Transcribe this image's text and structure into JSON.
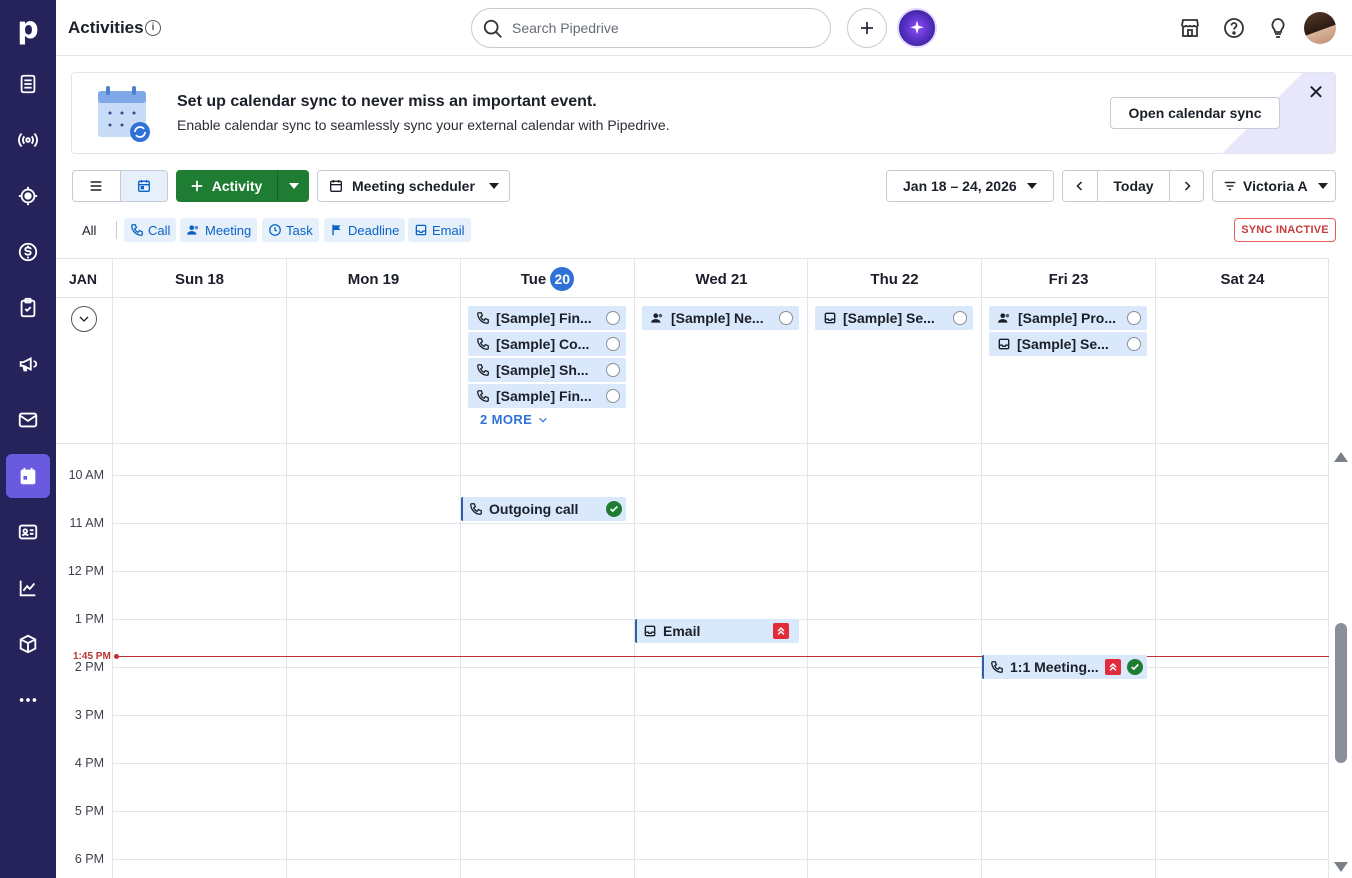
{
  "sidebar": {
    "logo": "p",
    "items": [
      {
        "icon": "leads-icon",
        "label": "Leads"
      },
      {
        "icon": "broadcast-icon",
        "label": "Deals"
      },
      {
        "icon": "target-icon",
        "label": "Projects"
      },
      {
        "icon": "dollar-icon",
        "label": "Sales"
      },
      {
        "icon": "clipboard-icon",
        "label": "Tasks"
      },
      {
        "icon": "megaphone-icon",
        "label": "Campaigns"
      },
      {
        "icon": "mail-icon",
        "label": "Mail"
      },
      {
        "icon": "calendar-icon",
        "label": "Activities",
        "active": true
      },
      {
        "icon": "contacts-icon",
        "label": "Contacts"
      },
      {
        "icon": "chart-icon",
        "label": "Insights"
      },
      {
        "icon": "box-icon",
        "label": "Products"
      },
      {
        "icon": "more-icon",
        "label": "More"
      }
    ]
  },
  "header": {
    "title": "Activities",
    "search_placeholder": "Search Pipedrive"
  },
  "banner": {
    "title": "Set up calendar sync to never miss an important event.",
    "subtitle": "Enable calendar sync to seamlessly sync your external calendar with Pipedrive.",
    "button": "Open calendar sync"
  },
  "toolbar": {
    "add_label": "Activity",
    "scheduler_label": "Meeting scheduler",
    "date_range": "Jan 18 – 24, 2026",
    "today_label": "Today",
    "user_filter": "Victoria A"
  },
  "filters": {
    "all": "All",
    "types": [
      "Call",
      "Meeting",
      "Task",
      "Deadline",
      "Email"
    ],
    "sync_status": "SYNC INACTIVE"
  },
  "calendar": {
    "month": "JAN",
    "days": [
      {
        "name": "Sun",
        "num": "18"
      },
      {
        "name": "Mon",
        "num": "19"
      },
      {
        "name": "Tue",
        "num": "20",
        "today": true
      },
      {
        "name": "Wed",
        "num": "21"
      },
      {
        "name": "Thu",
        "num": "22"
      },
      {
        "name": "Fri",
        "num": "23"
      },
      {
        "name": "Sat",
        "num": "24"
      }
    ],
    "allday_events": {
      "tue": [
        "[Sample] Fin...",
        "[Sample] Co...",
        "[Sample] Sh...",
        "[Sample] Fin..."
      ],
      "tue_more": "2 MORE",
      "wed": [
        "[Sample] Ne..."
      ],
      "thu": [
        "[Sample] Se..."
      ],
      "fri": [
        "[Sample] Pro...",
        "[Sample] Se..."
      ]
    },
    "hours": [
      "10 AM",
      "11 AM",
      "12 PM",
      "1 PM",
      "2 PM",
      "3 PM",
      "4 PM",
      "5 PM",
      "6 PM"
    ],
    "now_label": "1:45 PM",
    "timed_events": {
      "tue_call": "Outgoing call",
      "wed_email": "Email",
      "fri_meeting": "1:1 Meeting..."
    }
  },
  "colors": {
    "sidebar": "#26235b",
    "accent": "#6a5ae0",
    "primary_green": "#1e7d32",
    "link_blue": "#0b62c4",
    "event_bg": "#d9e9fb",
    "now_line": "#bb3333"
  }
}
